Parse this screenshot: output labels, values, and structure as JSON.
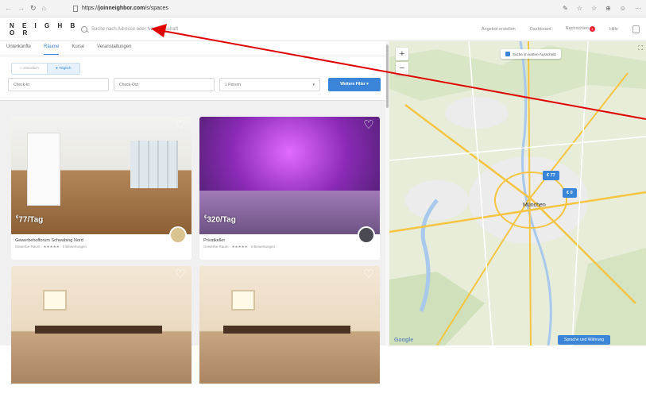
{
  "browser": {
    "url_prefix": "https://",
    "url_domain": "joinneighbor.com",
    "url_path": "/s/spaces",
    "nav": [
      "←",
      "→",
      "↻",
      "⌂"
    ],
    "tools": [
      "✎",
      "☆",
      "☆",
      "⊕",
      "☺",
      "···"
    ]
  },
  "header": {
    "logo": "N E I G H B O R",
    "search_placeholder": "Suche nach Adresse oder Nachbarschaft",
    "links": [
      "Angebot erstellen",
      "Dashboard",
      "Nachrichten",
      "Hilfe"
    ],
    "messages_badge": "1"
  },
  "tabs": [
    "Unterkünfte",
    "Räume",
    "Kurse",
    "Veranstaltungen"
  ],
  "active_tab": "Räume",
  "toggle": {
    "hourly": "Stündlich",
    "daily": "Täglich"
  },
  "filters": {
    "checkin": "Check-In",
    "checkout": "Check-Out",
    "persons": "1 Person",
    "more_filters": "Weitere Filter ▾"
  },
  "listings": [
    {
      "price": "77/Tag",
      "currency": "€",
      "title": "Gewerbehofforum Schwabing Nord",
      "meta": "Gewerbe Raum · ★★★★★ · 0 Bewertungen"
    },
    {
      "price": "320/Tag",
      "currency": "€",
      "title": "Privatkeller",
      "meta": "Gewerbe Raum · ★★★★★ · 0 Bewertungen"
    },
    {
      "price": "",
      "currency": "",
      "title": "",
      "meta": ""
    },
    {
      "price": "",
      "currency": "",
      "title": "",
      "meta": ""
    }
  ],
  "map": {
    "search_on_move": "Suche im karten-Ausschnitt",
    "city": "München",
    "pins": [
      "€ 77",
      "€ 0"
    ],
    "lang_button": "Sprache und Währung",
    "google": "Google",
    "zoom_in": "+",
    "zoom_out": "−"
  },
  "colors": {
    "accent": "#3a85d8",
    "annotation": "#e00000"
  }
}
